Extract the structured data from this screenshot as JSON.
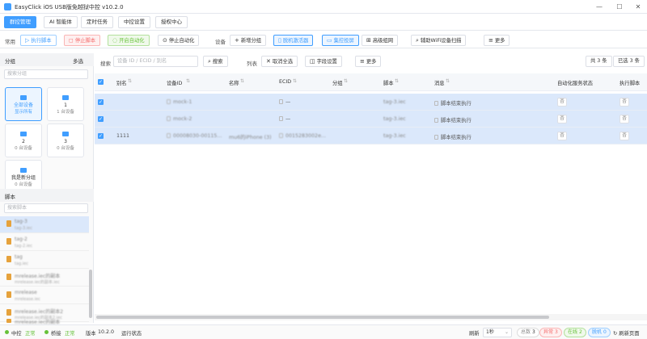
{
  "window": {
    "title": "EasyClick iOS USB版免越狱中控 v10.2.0"
  },
  "nav_tabs": [
    "群控管理",
    "AI 智能体",
    "定时任务",
    "中控设置",
    "授权中心"
  ],
  "toolbar": {
    "common_label": "常用",
    "run": "执行脚本",
    "stop": "停止脚本",
    "start_auto": "开启自动化",
    "stop_auto": "停止自动化",
    "device_label": "设备",
    "add_group": "新增分组",
    "activator": "脱机激活器",
    "cast": "集控投屏",
    "advanced_network": "高级组网",
    "wifi_scan": "辅助WiFi设备扫描",
    "more": "更多"
  },
  "sidebar": {
    "group_title": "分组",
    "multi_select": "多选",
    "group_search_placeholder": "搜索分组",
    "groups": [
      {
        "name": "全部设备",
        "count": "显示所有"
      },
      {
        "name": "1",
        "count": "1 台设备"
      },
      {
        "name": "2",
        "count": "0 台设备"
      },
      {
        "name": "3",
        "count": "0 台设备"
      },
      {
        "name": "我是新分组",
        "count": "0 台设备"
      }
    ],
    "script_title": "脚本",
    "script_search_placeholder": "搜索脚本",
    "scripts": [
      {
        "name": "tag-3",
        "file": "tag-3.iec"
      },
      {
        "name": "tag-2",
        "file": "tag-2.iec"
      },
      {
        "name": "tag",
        "file": "tag.iec"
      },
      {
        "name": "mrelease.iec的副本",
        "file": "mrelease.iec的副本.iec"
      },
      {
        "name": "mrelease",
        "file": "mrelease.iec"
      },
      {
        "name": "mrelease.iec的副本2",
        "file": "mrelease.iec的副本2.iec"
      },
      {
        "name": "mrelease.iec的副本",
        "file": ""
      }
    ]
  },
  "search": {
    "label": "搜索",
    "placeholder": "设备 ID / ECID / 别名",
    "button": "搜索",
    "columns_label": "列表",
    "deselect_all": "取消全选",
    "field_settings": "字段设置",
    "more": "更多",
    "total": "共 3 条",
    "selected": "已选 3 条"
  },
  "table": {
    "headers": [
      "别名",
      "设备ID",
      "名称",
      "ECID",
      "分组",
      "脚本",
      "消息",
      "自动化服务状态",
      "执行脚本"
    ],
    "rows": [
      {
        "alias": "",
        "device_id": "mock-1",
        "name": "",
        "ecid": "—",
        "group": "",
        "script": "tag-3.iec",
        "message": "脚本结束执行",
        "auto_status": "否",
        "exec": "否"
      },
      {
        "alias": "",
        "device_id": "mock-2",
        "name": "",
        "ecid": "—",
        "group": "",
        "script": "tag-3.iec",
        "message": "脚本结束执行",
        "auto_status": "否",
        "exec": "否"
      },
      {
        "alias": "1111",
        "device_id": "00008030-00115...",
        "name": "mu6的iPhone (3)",
        "ecid": "0015283002e...",
        "group": "",
        "script": "tag-3.iec",
        "message": "脚本结束执行",
        "auto_status": "否",
        "exec": "否"
      }
    ]
  },
  "status": {
    "control": "中控",
    "control_state": "正常",
    "bridge": "桥接",
    "bridge_state": "正常",
    "version_label": "版本",
    "version": "10.2.0",
    "run_state": "运行状态",
    "refresh_label": "刷新",
    "refresh_value": "1秒",
    "total_label": "总数",
    "total": "3",
    "error_label": "异常",
    "error": "3",
    "online_label": "在线",
    "online": "2",
    "offline_label": "脱机",
    "offline": "0",
    "refresh_page": "刷新页面"
  },
  "colors": {
    "accent": "#409eff",
    "selected_row": "#dbe8fb",
    "danger": "#f56c6c",
    "success": "#67c23a"
  }
}
